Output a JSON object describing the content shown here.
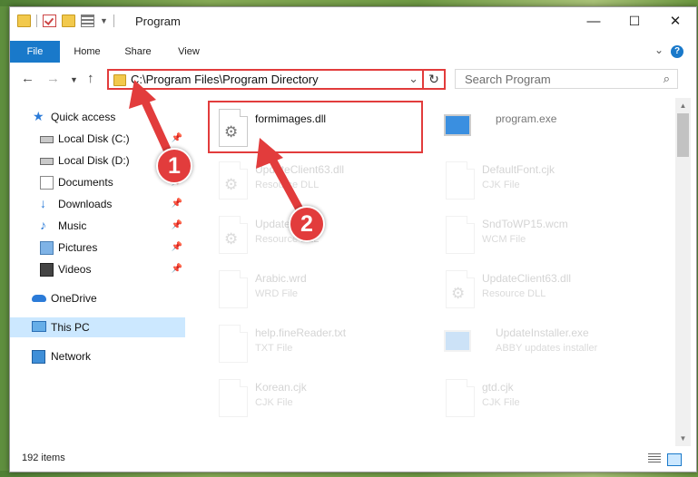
{
  "window": {
    "title": "Program",
    "controls": {
      "minimize": "—",
      "maximize": "☐",
      "close": "✕"
    }
  },
  "ribbon": {
    "tabs": [
      "File",
      "Home",
      "Share",
      "View"
    ],
    "help": "?"
  },
  "navigation": {
    "address_path": "C:\\Program Files\\Program Directory",
    "search_placeholder": "Search Program"
  },
  "sidebar": {
    "items": [
      {
        "label": "Quick access",
        "icon": "star-icon"
      },
      {
        "label": "Local Disk (C:)",
        "icon": "drive-icon",
        "pinned": true
      },
      {
        "label": "Local Disk (D:)",
        "icon": "drive-icon"
      },
      {
        "label": "Documents",
        "icon": "documents-icon",
        "pinned": true
      },
      {
        "label": "Downloads",
        "icon": "downloads-icon",
        "pinned": true
      },
      {
        "label": "Music",
        "icon": "music-icon",
        "pinned": true
      },
      {
        "label": "Pictures",
        "icon": "pictures-icon",
        "pinned": true
      },
      {
        "label": "Videos",
        "icon": "videos-icon",
        "pinned": true
      },
      {
        "label": "OneDrive",
        "icon": "onedrive-icon"
      },
      {
        "label": "This PC",
        "icon": "this-pc-icon",
        "selected": true
      },
      {
        "label": "Network",
        "icon": "network-icon"
      }
    ]
  },
  "files": [
    {
      "name": "formimages.dll",
      "type": "",
      "icon": "dll-file-icon"
    },
    {
      "name": "program.exe",
      "type": "",
      "icon": "exe-file-icon"
    },
    {
      "name": "UpdateClient63.dll",
      "type": "Resource DLL",
      "icon": "dll-file-icon"
    },
    {
      "name": "DefaultFont.cjk",
      "type": "CJK File",
      "icon": "file-icon"
    },
    {
      "name": "Update...21.dll",
      "type": "Resource DLL",
      "icon": "dll-file-icon"
    },
    {
      "name": "SndToWP15.wcm",
      "type": "WCM File",
      "icon": "file-icon"
    },
    {
      "name": "Arabic.wrd",
      "type": "WRD File",
      "icon": "file-icon"
    },
    {
      "name": "UpdateClient63.dll",
      "type": "Resource DLL",
      "icon": "dll-file-icon"
    },
    {
      "name": "help.fineReader.txt",
      "type": "TXT File",
      "icon": "file-icon"
    },
    {
      "name": "UpdateInstaller.exe",
      "type": "ABBY updates installer",
      "icon": "exe-file-icon"
    },
    {
      "name": "Korean.cjk",
      "type": "CJK File",
      "icon": "file-icon"
    },
    {
      "name": "gtd.cjk",
      "type": "CJK File",
      "icon": "file-icon"
    }
  ],
  "status": {
    "item_count": "192 items"
  },
  "annotations": {
    "step1": "1",
    "step2": "2",
    "color": "#e23c3c"
  }
}
